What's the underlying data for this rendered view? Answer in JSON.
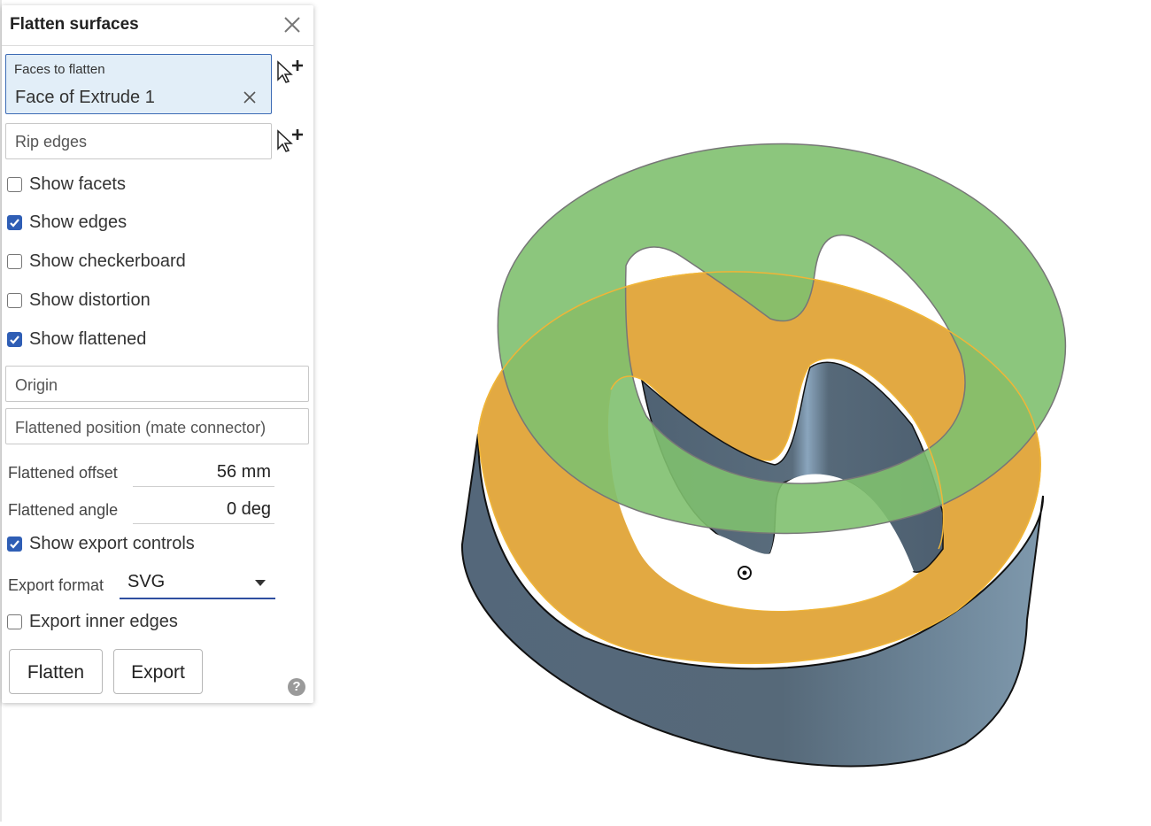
{
  "panel": {
    "title": "Flatten surfaces",
    "faces_to_flatten": {
      "label": "Faces to flatten",
      "selection": "Face of Extrude 1"
    },
    "rip_edges": {
      "placeholder": "Rip edges"
    },
    "checkboxes": {
      "show_facets": {
        "label": "Show facets",
        "checked": false
      },
      "show_edges": {
        "label": "Show edges",
        "checked": true
      },
      "show_checkerboard": {
        "label": "Show checkerboard",
        "checked": false
      },
      "show_distortion": {
        "label": "Show distortion",
        "checked": false
      },
      "show_flattened": {
        "label": "Show flattened",
        "checked": true
      },
      "show_export_controls": {
        "label": "Show export controls",
        "checked": true
      },
      "export_inner_edges": {
        "label": "Export inner edges",
        "checked": false
      }
    },
    "origin": {
      "placeholder": "Origin"
    },
    "flattened_position": {
      "placeholder": "Flattened position (mate connector)"
    },
    "flattened_offset": {
      "label": "Flattened offset",
      "value": "56 mm"
    },
    "flattened_angle": {
      "label": "Flattened angle",
      "value": "0 deg"
    },
    "export_format": {
      "label": "Export format",
      "value": "SVG"
    },
    "buttons": {
      "flatten": "Flatten",
      "export": "Export"
    },
    "help": "?"
  },
  "colors": {
    "accent": "#2f5eb5",
    "selection_bg": "#e2eef8",
    "flattened_face": "#8bc47e",
    "selected_face": "#e2a942",
    "body": "#566876"
  }
}
